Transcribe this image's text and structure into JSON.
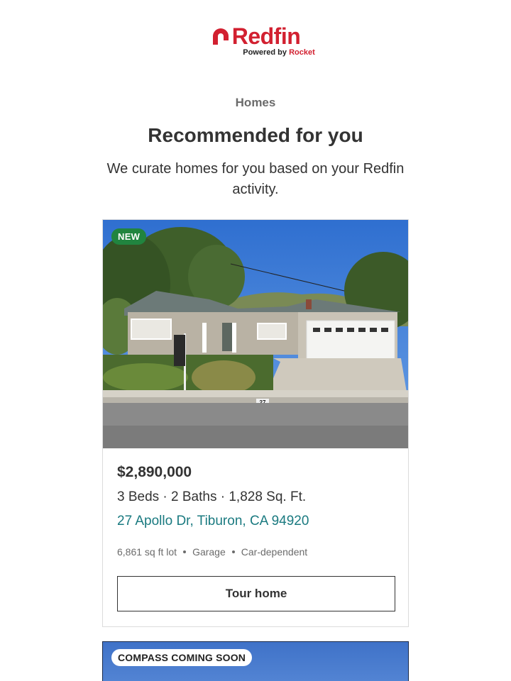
{
  "brand": {
    "name": "Redfin",
    "tagline_prefix": "Powered by",
    "tagline_partner": "Rocket",
    "color": "#d22030"
  },
  "header": {
    "eyebrow": "Homes",
    "title": "Recommended for you",
    "subtitle": "We curate homes for you based on your Redfin activity."
  },
  "listings": [
    {
      "badge": "NEW",
      "badge_color": "#21843f",
      "price": "$2,890,000",
      "specs": "3 Beds · 2 Baths · 1,828 Sq. Ft.",
      "address": "27 Apollo Dr, Tiburon, CA 94920",
      "features": [
        "6,861 sq ft lot",
        "Garage",
        "Car-dependent"
      ],
      "cta": "Tour home",
      "curb_number": "27"
    },
    {
      "badge": "COMPASS COMING SOON"
    }
  ],
  "colors": {
    "address_link": "#1a7a80",
    "text": "#333333",
    "muted": "#6b6b6b"
  }
}
